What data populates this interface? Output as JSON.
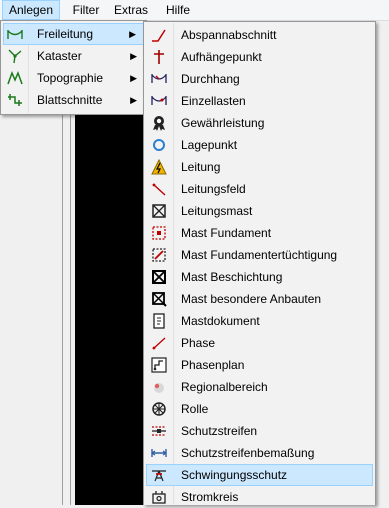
{
  "menubar": {
    "items": [
      {
        "label": "Anlegen"
      },
      {
        "label": "Filter"
      },
      {
        "label": "Extras"
      },
      {
        "label": "Hilfe"
      }
    ]
  },
  "anlegen_menu": {
    "items": [
      {
        "label": "Freileitung",
        "icon": "freileitung-icon",
        "highlighted": true
      },
      {
        "label": "Kataster",
        "icon": "kataster-icon"
      },
      {
        "label": "Topographie",
        "icon": "topographie-icon"
      },
      {
        "label": "Blattschnitte",
        "icon": "blattschnitte-icon"
      }
    ],
    "submenu_arrow": "▶"
  },
  "freileitung_menu": {
    "items": [
      {
        "label": "Abspannabschnitt",
        "icon": "abspannabschnitt-icon"
      },
      {
        "label": "Aufhängepunkt",
        "icon": "aufhaengepunkt-icon"
      },
      {
        "label": "Durchhang",
        "icon": "durchhang-icon"
      },
      {
        "label": "Einzellasten",
        "icon": "einzellasten-icon"
      },
      {
        "label": "Gewährleistung",
        "icon": "gewaehrleistung-icon"
      },
      {
        "label": "Lagepunkt",
        "icon": "lagepunkt-icon"
      },
      {
        "label": "Leitung",
        "icon": "leitung-icon"
      },
      {
        "label": "Leitungsfeld",
        "icon": "leitungsfeld-icon"
      },
      {
        "label": "Leitungsmast",
        "icon": "leitungsmast-icon"
      },
      {
        "label": "Mast Fundament",
        "icon": "mast-fundament-icon"
      },
      {
        "label": "Mast Fundamentertüchtigung",
        "icon": "mast-fundamentertuechtigung-icon"
      },
      {
        "label": "Mast Beschichtung",
        "icon": "mast-beschichtung-icon"
      },
      {
        "label": "Mast besondere Anbauten",
        "icon": "mast-besondere-anbauten-icon"
      },
      {
        "label": "Mastdokument",
        "icon": "mastdokument-icon"
      },
      {
        "label": "Phase",
        "icon": "phase-icon"
      },
      {
        "label": "Phasenplan",
        "icon": "phasenplan-icon"
      },
      {
        "label": "Regionalbereich",
        "icon": "regionalbereich-icon"
      },
      {
        "label": "Rolle",
        "icon": "rolle-icon"
      },
      {
        "label": "Schutzstreifen",
        "icon": "schutzstreifen-icon"
      },
      {
        "label": "Schutzstreifenbemaßung",
        "icon": "schutzstreifenbemassung-icon"
      },
      {
        "label": "Schwingungsschutz",
        "icon": "schwingungsschutz-icon",
        "highlighted": true
      },
      {
        "label": "Stromkreis",
        "icon": "stromkreis-icon"
      }
    ]
  },
  "colors": {
    "highlight_fill": "#cce8ff",
    "highlight_border": "#99d1ff",
    "menu_bg": "#f2f2f2",
    "icon_green": "#1a7a1a",
    "icon_red": "#c00000"
  }
}
